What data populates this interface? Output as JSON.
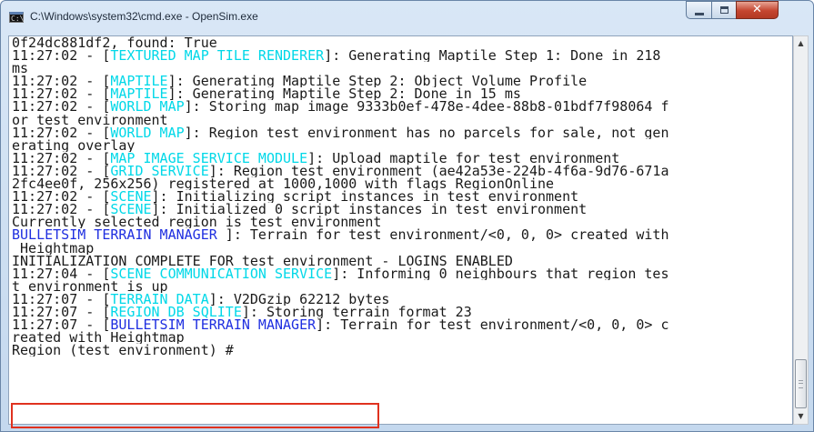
{
  "window": {
    "title": "C:\\Windows\\system32\\cmd.exe - OpenSim.exe",
    "icon": "cmd-icon",
    "icon_text": "C:\\",
    "controls": {
      "minimize": "minimize-icon",
      "maximize": "maximize-icon",
      "close": "close-icon",
      "close_glyph": "✕"
    }
  },
  "console": {
    "lines": [
      {
        "pre": "0f24dc881df2, found: True",
        "tag": "",
        "post": ""
      },
      {
        "pre": "11:27:02 - [",
        "tag": "TEXTURED MAP TILE RENDERER",
        "post": "]: Generating Maptile Step 1: Done in 218"
      },
      {
        "pre": "ms",
        "tag": "",
        "post": ""
      },
      {
        "pre": "11:27:02 - [",
        "tag": "MAPTILE",
        "post": "]: Generating Maptile Step 2: Object Volume Profile"
      },
      {
        "pre": "11:27:02 - [",
        "tag": "MAPTILE",
        "post": "]: Generating Maptile Step 2: Done in 15 ms"
      },
      {
        "pre": "11:27:02 - [",
        "tag": "WORLD MAP",
        "post": "]: Storing map image 9333b0ef-478e-4dee-88b8-01bdf7f98064 f"
      },
      {
        "pre": "or test environment",
        "tag": "",
        "post": ""
      },
      {
        "pre": "11:27:02 - [",
        "tag": "WORLD MAP",
        "post": "]: Region test environment has no parcels for sale, not gen"
      },
      {
        "pre": "erating overlay",
        "tag": "",
        "post": ""
      },
      {
        "pre": "11:27:02 - [",
        "tag": "MAP IMAGE SERVICE MODULE",
        "post": "]: Upload maptile for test environment"
      },
      {
        "pre": "11:27:02 - [",
        "tag": "GRID SERVICE",
        "post": "]: Region test environment (ae42a53e-224b-4f6a-9d76-671a"
      },
      {
        "pre": "2fc4ee0f, 256x256) registered at 1000,1000 with flags RegionOnline",
        "tag": "",
        "post": ""
      },
      {
        "pre": "11:27:02 - [",
        "tag": "SCENE",
        "post": "]: Initializing script instances in test environment"
      },
      {
        "pre": "11:27:02 - [",
        "tag": "SCENE",
        "post": "]: Initialized 0 script instances in test environment"
      },
      {
        "pre": "Currently selected region is test environment",
        "tag": "",
        "post": ""
      },
      {
        "pre": "",
        "tag2": "BULLETSIM TERRAIN MANAGER",
        "post": " ]: Terrain for test environment/<0, 0, 0> created with"
      },
      {
        "pre": " Heightmap",
        "tag": "",
        "post": ""
      },
      {
        "pre": "INITIALIZATION COMPLETE FOR test environment - LOGINS ENABLED",
        "tag": "",
        "post": ""
      },
      {
        "pre": "11:27:04 - [",
        "tag": "SCENE COMMUNICATION SERVICE",
        "post": "]: Informing 0 neighbours that region tes"
      },
      {
        "pre": "t environment is up",
        "tag": "",
        "post": ""
      },
      {
        "pre": "11:27:07 - [",
        "tag": "TERRAIN DATA",
        "post": "]: V2DGzip 62212 bytes"
      },
      {
        "pre": "11:27:07 - [",
        "tag": "REGION DB SQLITE",
        "post": "]: Storing terrain format 23"
      },
      {
        "pre": "11:27:07 - [",
        "tag2": "BULLETSIM TERRAIN MANAGER",
        "post": "]: Terrain for test environment/<0, 0, 0> c"
      },
      {
        "pre": "reated with Heightmap",
        "tag": "",
        "post": ""
      },
      {
        "pre": "Region (test environment) # ",
        "tag": "",
        "post": ""
      }
    ]
  },
  "colors": {
    "tag": "#00d8e8",
    "tag_blue": "#1f2fe0",
    "highlight": "#e0321f"
  }
}
